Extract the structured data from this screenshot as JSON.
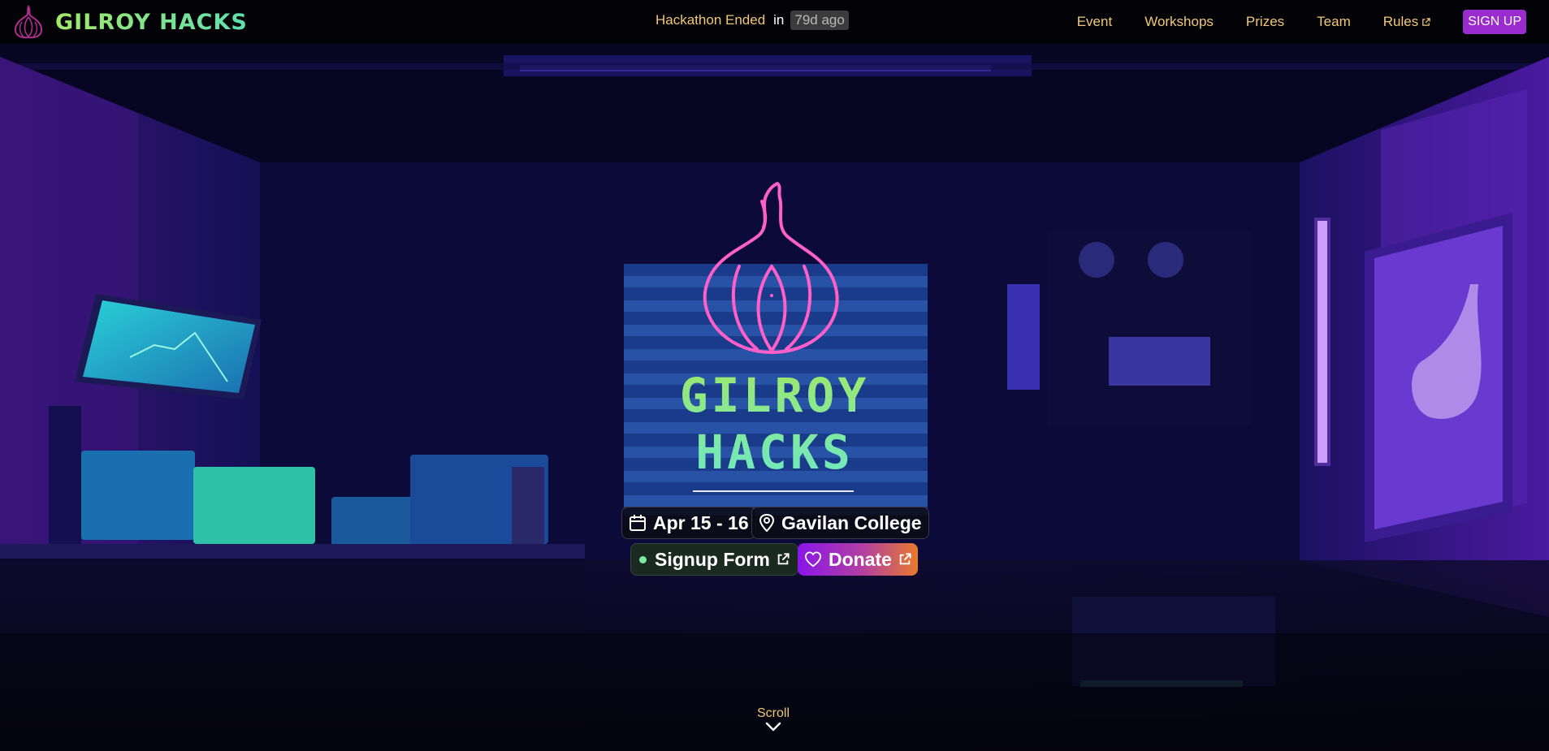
{
  "navbar": {
    "brand_name": "GILROY HACKS",
    "countdown_label": "Hackathon Ended",
    "countdown_in": "in",
    "countdown_value": "79d ago",
    "links": [
      {
        "label": "Event"
      },
      {
        "label": "Workshops"
      },
      {
        "label": "Prizes"
      },
      {
        "label": "Team"
      },
      {
        "label": "Rules",
        "icon": "external-link-icon"
      }
    ],
    "signup_label": "SIGN UP"
  },
  "hero": {
    "title_line1": "GILROY",
    "title_line2": "HACKS",
    "date": "Apr 15 - 16",
    "location": "Gavilan College",
    "signup_form_label": "Signup Form",
    "donate_label": "Donate",
    "scroll_label": "Scroll"
  },
  "colors": {
    "nav_text": "#f2c878",
    "signup_button": "#9a2ccf",
    "title_gradient": [
      "#9de86a",
      "#6fe8c0"
    ],
    "garlic_neon": "#ff5fc8",
    "donate_gradient": [
      "#8a16e8",
      "#e87a2c"
    ]
  }
}
